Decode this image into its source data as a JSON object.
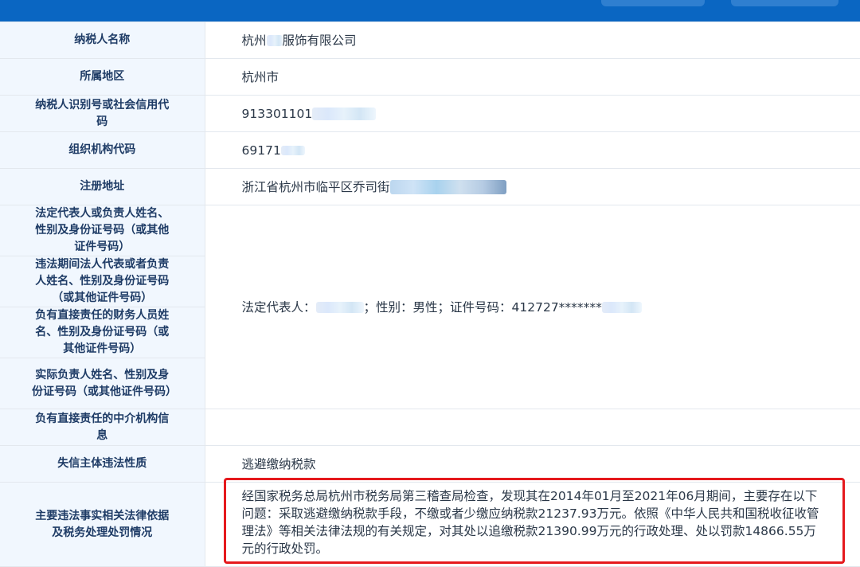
{
  "rows": {
    "taxpayer_name": {
      "label": "纳税人名称",
      "value_prefix": "杭州",
      "value_suffix": "服饰有限公司"
    },
    "region": {
      "label": "所属地区",
      "value": "杭州市"
    },
    "tax_id": {
      "label": "纳税人识别号或社会信用代码",
      "value": "913301101"
    },
    "org_code": {
      "label": "组织机构代码",
      "value": "69171"
    },
    "address": {
      "label": "注册地址",
      "value": "浙江省杭州市临平区乔司街"
    },
    "legal_rep": {
      "label": "法定代表人或负责人姓名、性别及身份证号码（或其他证件号码）"
    },
    "violation_rep": {
      "label": "违法期间法人代表或者负责人姓名、性别及身份证号码（或其他证件号码）"
    },
    "finance_person": {
      "label": "负有直接责任的财务人员姓名、性别及身份证号码（或其他证件号码）"
    },
    "actual_person": {
      "label": "实际负责人姓名、性别及身份证号码（或其他证件号码）"
    },
    "agency": {
      "label": "负有直接责任的中介机构信息"
    },
    "nature": {
      "label": "失信主体违法性质",
      "value": "逃避缴纳税款"
    },
    "facts": {
      "label": "主要违法事实相关法律依据及税务处理处罚情况",
      "value": "经国家税务总局杭州市税务局第三稽查局检查，发现其在2014年01月至2021年06月期间，主要存在以下问题：采取逃避缴纳税款手段，不缴或者少缴应纳税款21237.93万元。依照《中华人民共和国税收征收管理法》等相关法律法规的有关规定，对其处以追缴税款21390.99万元的行政处理、处以罚款14866.55万元的行政处罚。"
    }
  },
  "legal_merged": {
    "rep_prefix": "法定代表人：",
    "rep_middle": "；性别：男性；证件号码：412727*******"
  },
  "colors": {
    "header": "#0a66c2",
    "label_bg": "#f1f7fe",
    "highlight": "#e5191d"
  }
}
